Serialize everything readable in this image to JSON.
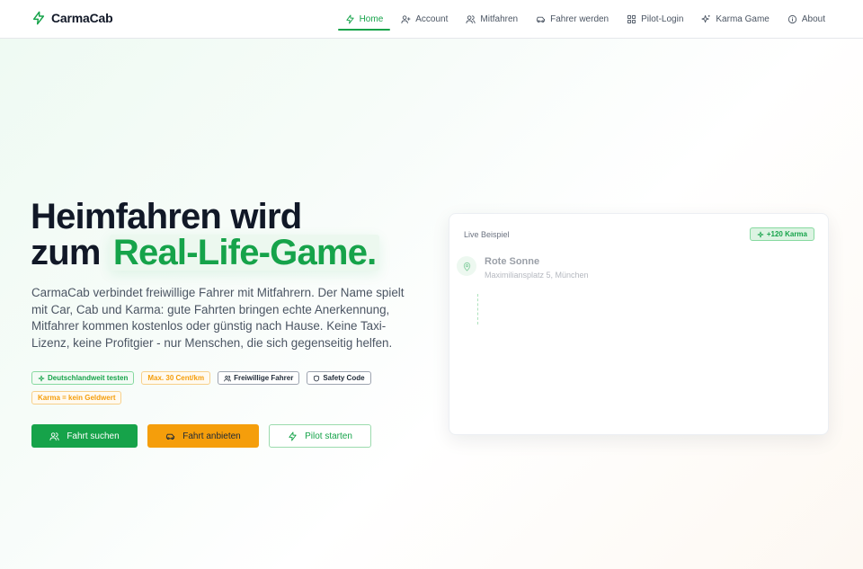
{
  "brand": {
    "name": "CarmaCab",
    "accent": "#16a34a"
  },
  "nav": {
    "items": [
      {
        "label": "Home",
        "icon": "bolt-icon",
        "active": true
      },
      {
        "label": "Account",
        "icon": "user-plus-icon"
      },
      {
        "label": "Mitfahren",
        "icon": "users-icon"
      },
      {
        "label": "Fahrer werden",
        "icon": "car-icon"
      },
      {
        "label": "Pilot-Login",
        "icon": "grid-icon"
      },
      {
        "label": "Karma Game",
        "icon": "sparkles-icon"
      },
      {
        "label": "About",
        "icon": "info-icon"
      }
    ]
  },
  "hero": {
    "title_line1": "Heimfahren wird",
    "title_line2_prefix": "zum ",
    "title_highlight": "Real-Life-Game.",
    "description": "CarmaCab verbindet freiwillige Fahrer mit Mitfahrern. Der Name spielt mit Car, Cab und Karma: gute Fahrten bringen echte Anerkennung, Mitfahrer kommen kostenlos oder günstig nach Hause. Keine Taxi-Lizenz, keine Profitgier - nur Menschen, die sich gegenseitig helfen.",
    "badges": [
      {
        "label": "Deutschlandweit testen",
        "icon": "sparkle-icon",
        "color": "#16a34a"
      },
      {
        "label": "Max. 30 Cent/km",
        "color": "#f59e0b"
      },
      {
        "label": "Freiwillige Fahrer",
        "icon": "users-icon",
        "color": "#1f2937"
      },
      {
        "label": "Safety Code",
        "icon": "shield-icon",
        "color": "#1f2937"
      },
      {
        "label": "Karma = kein Geldwert",
        "color": "#f59e0b"
      }
    ],
    "buttons": {
      "search": "Fahrt suchen",
      "offer": "Fahrt anbieten",
      "pilot": "Pilot starten"
    }
  },
  "live_example": {
    "label": "Live Beispiel",
    "karma": "+120 Karma",
    "stop_name": "Rote Sonne",
    "stop_address": "Maximiliansplatz 5, München"
  }
}
